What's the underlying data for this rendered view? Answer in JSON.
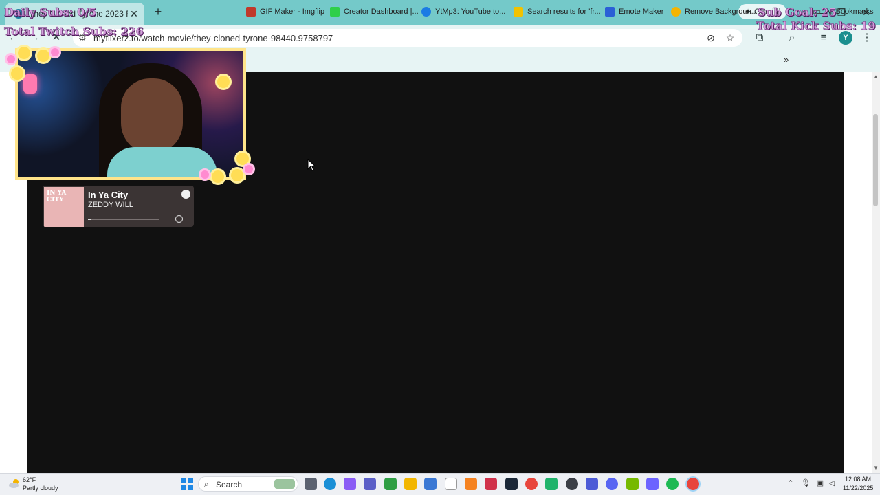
{
  "browser": {
    "tab": {
      "title": "They Cloned Tyrone 2023 Full m"
    },
    "newtab_label": "+",
    "gemini_label": "Gemini",
    "url": "myflixerz.to/watch-movie/they-cloned-tyrone-98440.9758797",
    "profile_initial": "Y"
  },
  "bookmarks": [
    {
      "label": "GIF Maker - Imgflip",
      "icon_color": "#c0392b"
    },
    {
      "label": "Creator Dashboard |...",
      "icon_color": "#2fcf4a"
    },
    {
      "label": "YtMp3: YouTube to...",
      "icon_color": "#1b7be4"
    },
    {
      "label": "Search results for 'fr...",
      "icon_color": "#f2c200"
    },
    {
      "label": "Emote Maker",
      "icon_color": "#2a5fd6"
    },
    {
      "label": "Remove Backgroun...",
      "icon_color": "#f5b400"
    }
  ],
  "all_bookmarks_label": "All Bookmarks",
  "overlay": {
    "daily_subs": "Daily Subs: 0/5",
    "total_twitch_subs": "Total Twitch Subs: 226",
    "sub_goal": "Sub Goal: 25",
    "total_kick_subs": "Total Kick Subs: 19"
  },
  "now_playing": {
    "album_text": "IN YA CITY",
    "song": "In Ya City",
    "artist": "ZEDDY WILL",
    "progress": 0.05
  },
  "taskbar": {
    "weather_temp": "62°F",
    "weather_desc": "Partly cloudy",
    "search_label": "Search",
    "time": "12:08 AM",
    "date": "11/22/2025"
  },
  "colors": {
    "accent": "#74c9c9",
    "video_bg": "#111111",
    "overlay_text": "#d5a0dc"
  }
}
